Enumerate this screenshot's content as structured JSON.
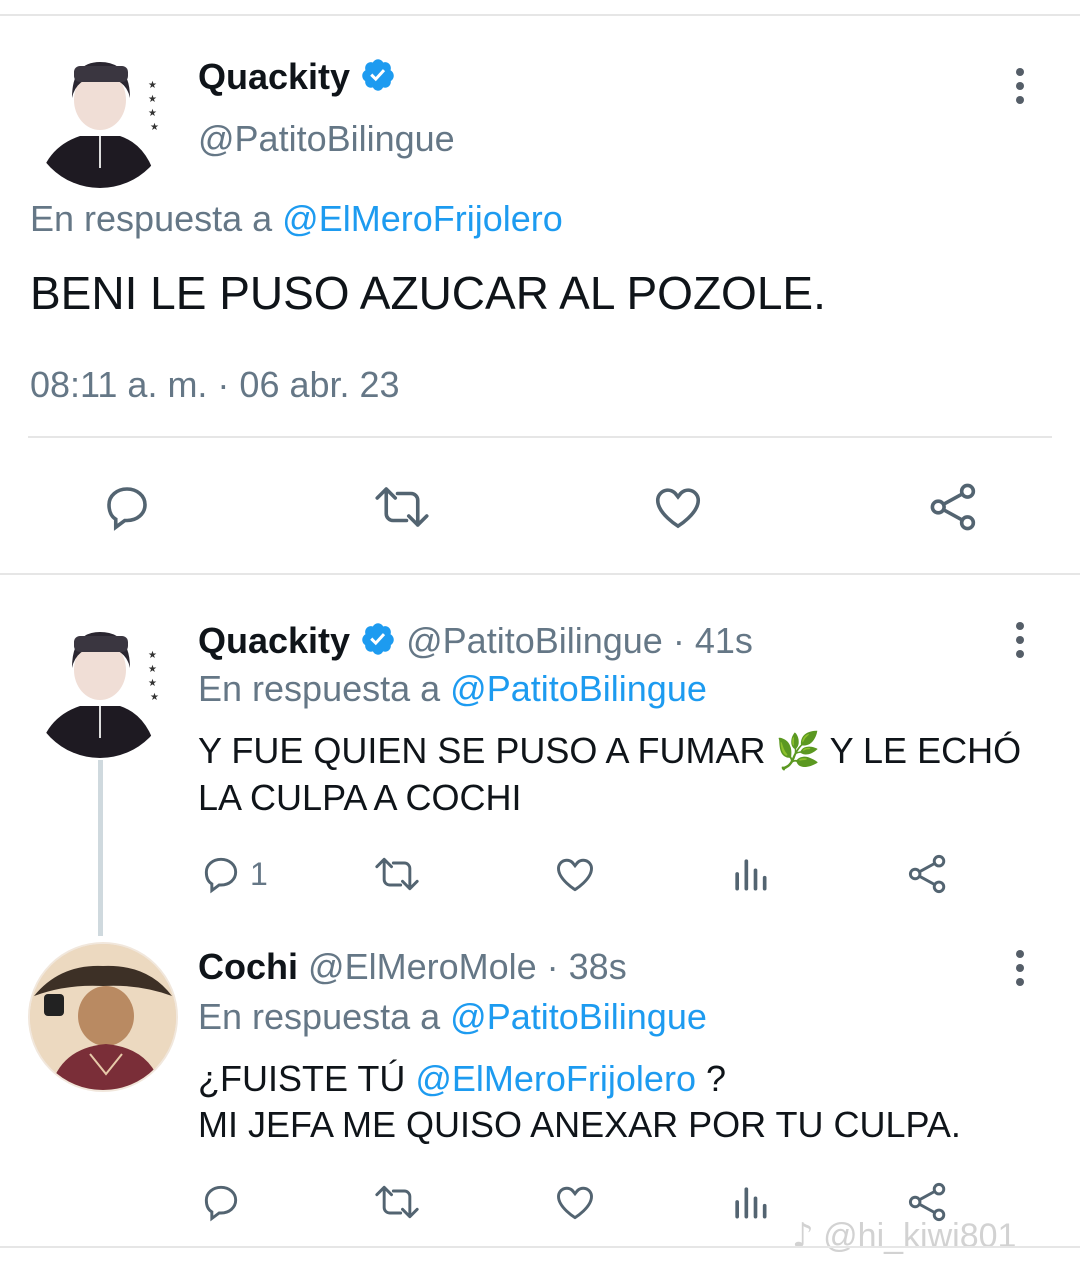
{
  "main_tweet": {
    "name": "Quackity",
    "handle": "@PatitoBilingue",
    "reply_prefix": "En respuesta a",
    "reply_to": "@ElMeroFrijolero",
    "text": "BENI LE PUSO AZUCAR AL POZOLE.",
    "timestamp": "08:11 a. m. · 06 abr. 23"
  },
  "reply1": {
    "name": "Quackity",
    "handle": "@PatitoBilingue",
    "time": "· 41s",
    "reply_prefix": "En respuesta a",
    "reply_to": "@PatitoBilingue",
    "text_line1": "Y FUE QUIEN SE PUSO A FUMAR",
    "emoji": "🌿",
    "text_line1b": "Y LE ECHÓ",
    "text_line2": "LA CULPA A COCHI",
    "reply_count": "1"
  },
  "reply2": {
    "name": "Cochi",
    "handle": "@ElMeroMole",
    "time": "· 38s",
    "reply_prefix": "En respuesta a",
    "reply_to": "@PatitoBilingue",
    "text_line1_pre": "¿FUISTE TÚ",
    "text_line1_mention": "@ElMeroFrijolero",
    "text_line1_post": "?",
    "text_line2": "MI JEFA ME QUISO ANEXAR POR TU CULPA."
  },
  "watermark": "@hi_kiwi801",
  "icons": {
    "reply": "reply-icon",
    "retweet": "retweet-icon",
    "like": "like-icon",
    "share": "share-icon",
    "views": "views-icon",
    "more": "more-icon",
    "verified": "verified-badge-icon"
  },
  "colors": {
    "accent": "#1d9bf0",
    "muted": "#657786",
    "text": "#0f1419"
  }
}
